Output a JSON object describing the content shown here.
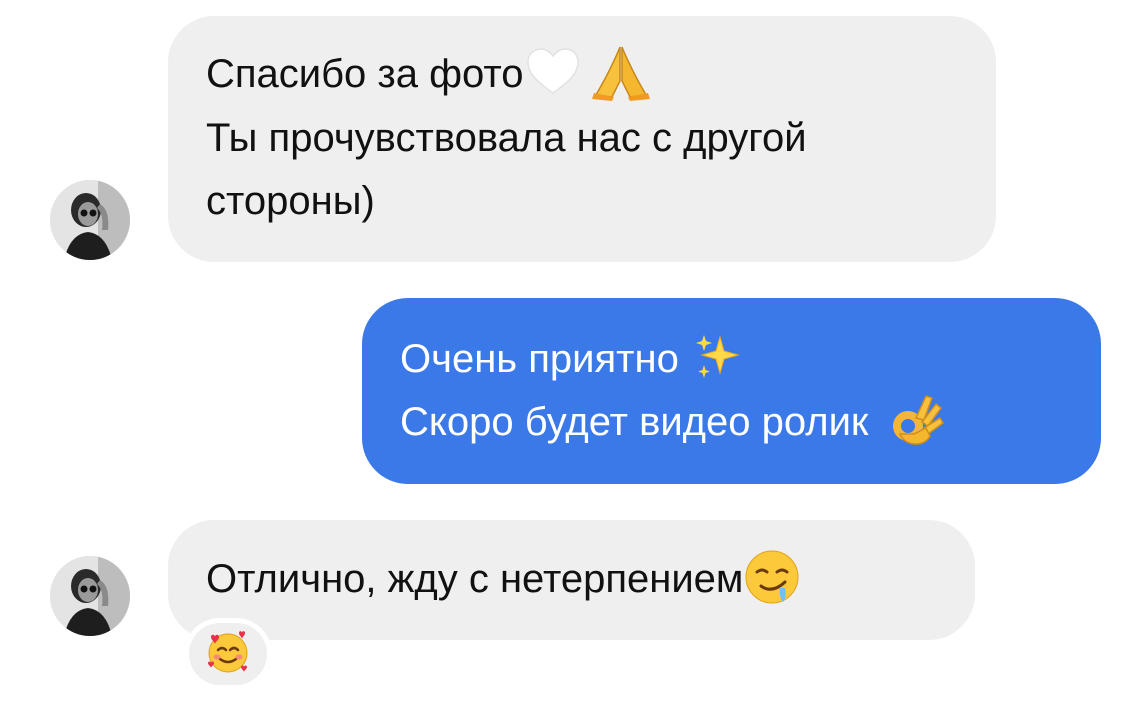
{
  "conversation": {
    "messages": [
      {
        "direction": "incoming",
        "lines": [
          {
            "text": "Спасибо за фото",
            "emojis": [
              "white-heart",
              "folded-hands"
            ]
          },
          {
            "text": "Ты прочувствовала нас с другой"
          },
          {
            "text": "стороны)"
          }
        ]
      },
      {
        "direction": "outgoing",
        "lines": [
          {
            "text": "Очень приятно",
            "emojis": [
              "sparkles"
            ]
          },
          {
            "text": "Скоро будет видео ролик",
            "emojis": [
              "ok-hand"
            ]
          }
        ]
      },
      {
        "direction": "incoming",
        "lines": [
          {
            "text": "Отлично, жду с нетерпением",
            "emojis": [
              "drooling-face"
            ]
          }
        ],
        "reaction": "smiling-face-with-hearts"
      }
    ]
  },
  "colors": {
    "incoming_bubble": "#efefef",
    "outgoing_bubble": "#3b79e8",
    "incoming_text": "#111111",
    "outgoing_text": "#ffffff",
    "background": "#ffffff"
  }
}
